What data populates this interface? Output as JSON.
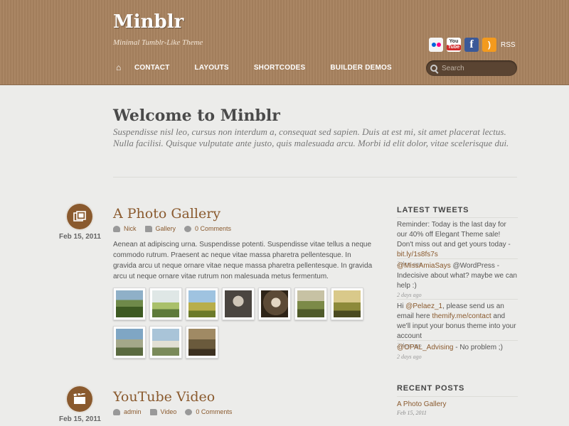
{
  "header": {
    "logo": "Minblr",
    "tagline": "Minimal Tumblr-Like Theme",
    "social": {
      "flickr_icon": "flickr-icon",
      "youtube_top": "You",
      "youtube_bottom": "Tube",
      "facebook_glyph": "f",
      "rss_glyph": ")",
      "rss_label": "RSS"
    },
    "nav": {
      "home_icon": "⌂",
      "items": [
        "CONTACT",
        "LAYOUTS",
        "SHORTCODES",
        "BUILDER DEMOS"
      ]
    },
    "search": {
      "placeholder": "Search"
    }
  },
  "welcome": {
    "title": "Welcome to Minblr",
    "text": "Suspendisse nisl leo, cursus non interdum a, consequat sed sapien. Duis at est mi, sit amet placerat lectus. Nulla facilisi. Quisque vulputate ante justo, quis malesuada arcu. Morbi id elit dolor, vitae scelerisque dui."
  },
  "posts": [
    {
      "date": "Feb 15, 2011",
      "title": "A Photo Gallery",
      "author": "Nick",
      "category": "Gallery",
      "comments": "0 Comments",
      "body": "Aenean at adipiscing urna. Suspendisse potenti. Suspendisse vitae tellus a neque commodo rutrum. Praesent ac neque vitae massa pharetra pellentesque. In gravida arcu ut neque ornare vitae neque massa pharetra pellentesque. In gravida arcu ut neque ornare vitae rutrum non malesuada metus fermentum."
    },
    {
      "date": "Feb 15, 2011",
      "title": "YouTube Video",
      "author": "admin",
      "category": "Video",
      "comments": "0 Comments"
    }
  ],
  "sidebar": {
    "tweets_title": "LATEST TWEETS",
    "tweets": [
      {
        "text": "Reminder: Today is the last day for our 40% off Elegant Theme sale! Don't miss out and get yours today - ",
        "link": "bit.ly/1s8fs7s",
        "ago": "2 days ago"
      },
      {
        "mention": "@MissAmiaSays",
        "text": " @WordPress - Indecisive about what? maybe we can help :)",
        "ago": "2 days ago"
      },
      {
        "pre": "Hi ",
        "mention": "@Pelaez_1",
        "text": ", please send us an email here ",
        "link": "themify.me/contact",
        "post": " and we'll input your bonus theme into your account",
        "ago": "2 days ago"
      },
      {
        "mention": "@OPAL_Advising",
        "text": " - No problem ;)",
        "ago": "2 days ago"
      }
    ],
    "recent_title": "RECENT POSTS",
    "recent": [
      {
        "title": "A Photo Gallery",
        "date": "Feb 15, 2011"
      }
    ]
  },
  "colors": {
    "header_bg": "#a7825f",
    "accent": "#8a5a2e",
    "page_bg": "#ececea"
  },
  "gallery_icons": [
    "landscape-photo-icon",
    "lake-photo-icon",
    "field-photo-icon",
    "portrait-photo-icon",
    "camera-photo-icon",
    "bench-photo-icon",
    "couple-photo-icon",
    "scooter-photo-icon",
    "sofa-photo-icon",
    "group-photo-icon"
  ]
}
